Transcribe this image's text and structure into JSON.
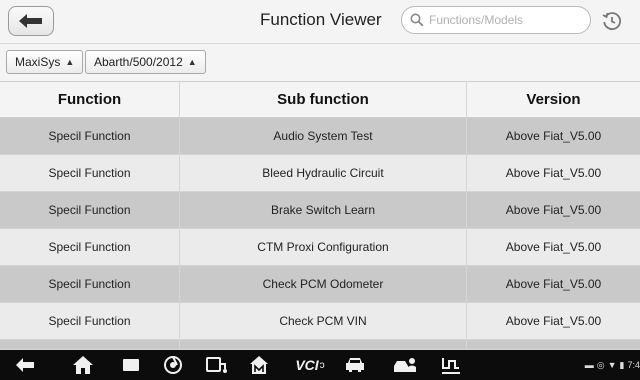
{
  "header": {
    "title": "Function Viewer",
    "search_placeholder": "Functions/Models"
  },
  "breadcrumbs": [
    {
      "label": "MaxiSys"
    },
    {
      "label": "Abarth/500/2012"
    }
  ],
  "table": {
    "headers": [
      "Function",
      "Sub function",
      "Version"
    ],
    "rows": [
      {
        "function": "Specil Function",
        "sub": "Audio System Test",
        "version": "Above Fiat_V5.00"
      },
      {
        "function": "Specil Function",
        "sub": "Bleed Hydraulic Circuit",
        "version": "Above Fiat_V5.00"
      },
      {
        "function": "Specil Function",
        "sub": "Brake Switch Learn",
        "version": "Above Fiat_V5.00"
      },
      {
        "function": "Specil Function",
        "sub": "CTM Proxi Configuration",
        "version": "Above Fiat_V5.00"
      },
      {
        "function": "Specil Function",
        "sub": "Check PCM Odometer",
        "version": "Above Fiat_V5.00"
      },
      {
        "function": "Specil Function",
        "sub": "Check PCM VIN",
        "version": "Above Fiat_V5.00"
      }
    ]
  },
  "navbar": {
    "vci_label": "VCI",
    "clock": "7:4"
  },
  "icons": {
    "back": "back-arrow-icon",
    "search": "search-icon",
    "history": "history-icon"
  }
}
